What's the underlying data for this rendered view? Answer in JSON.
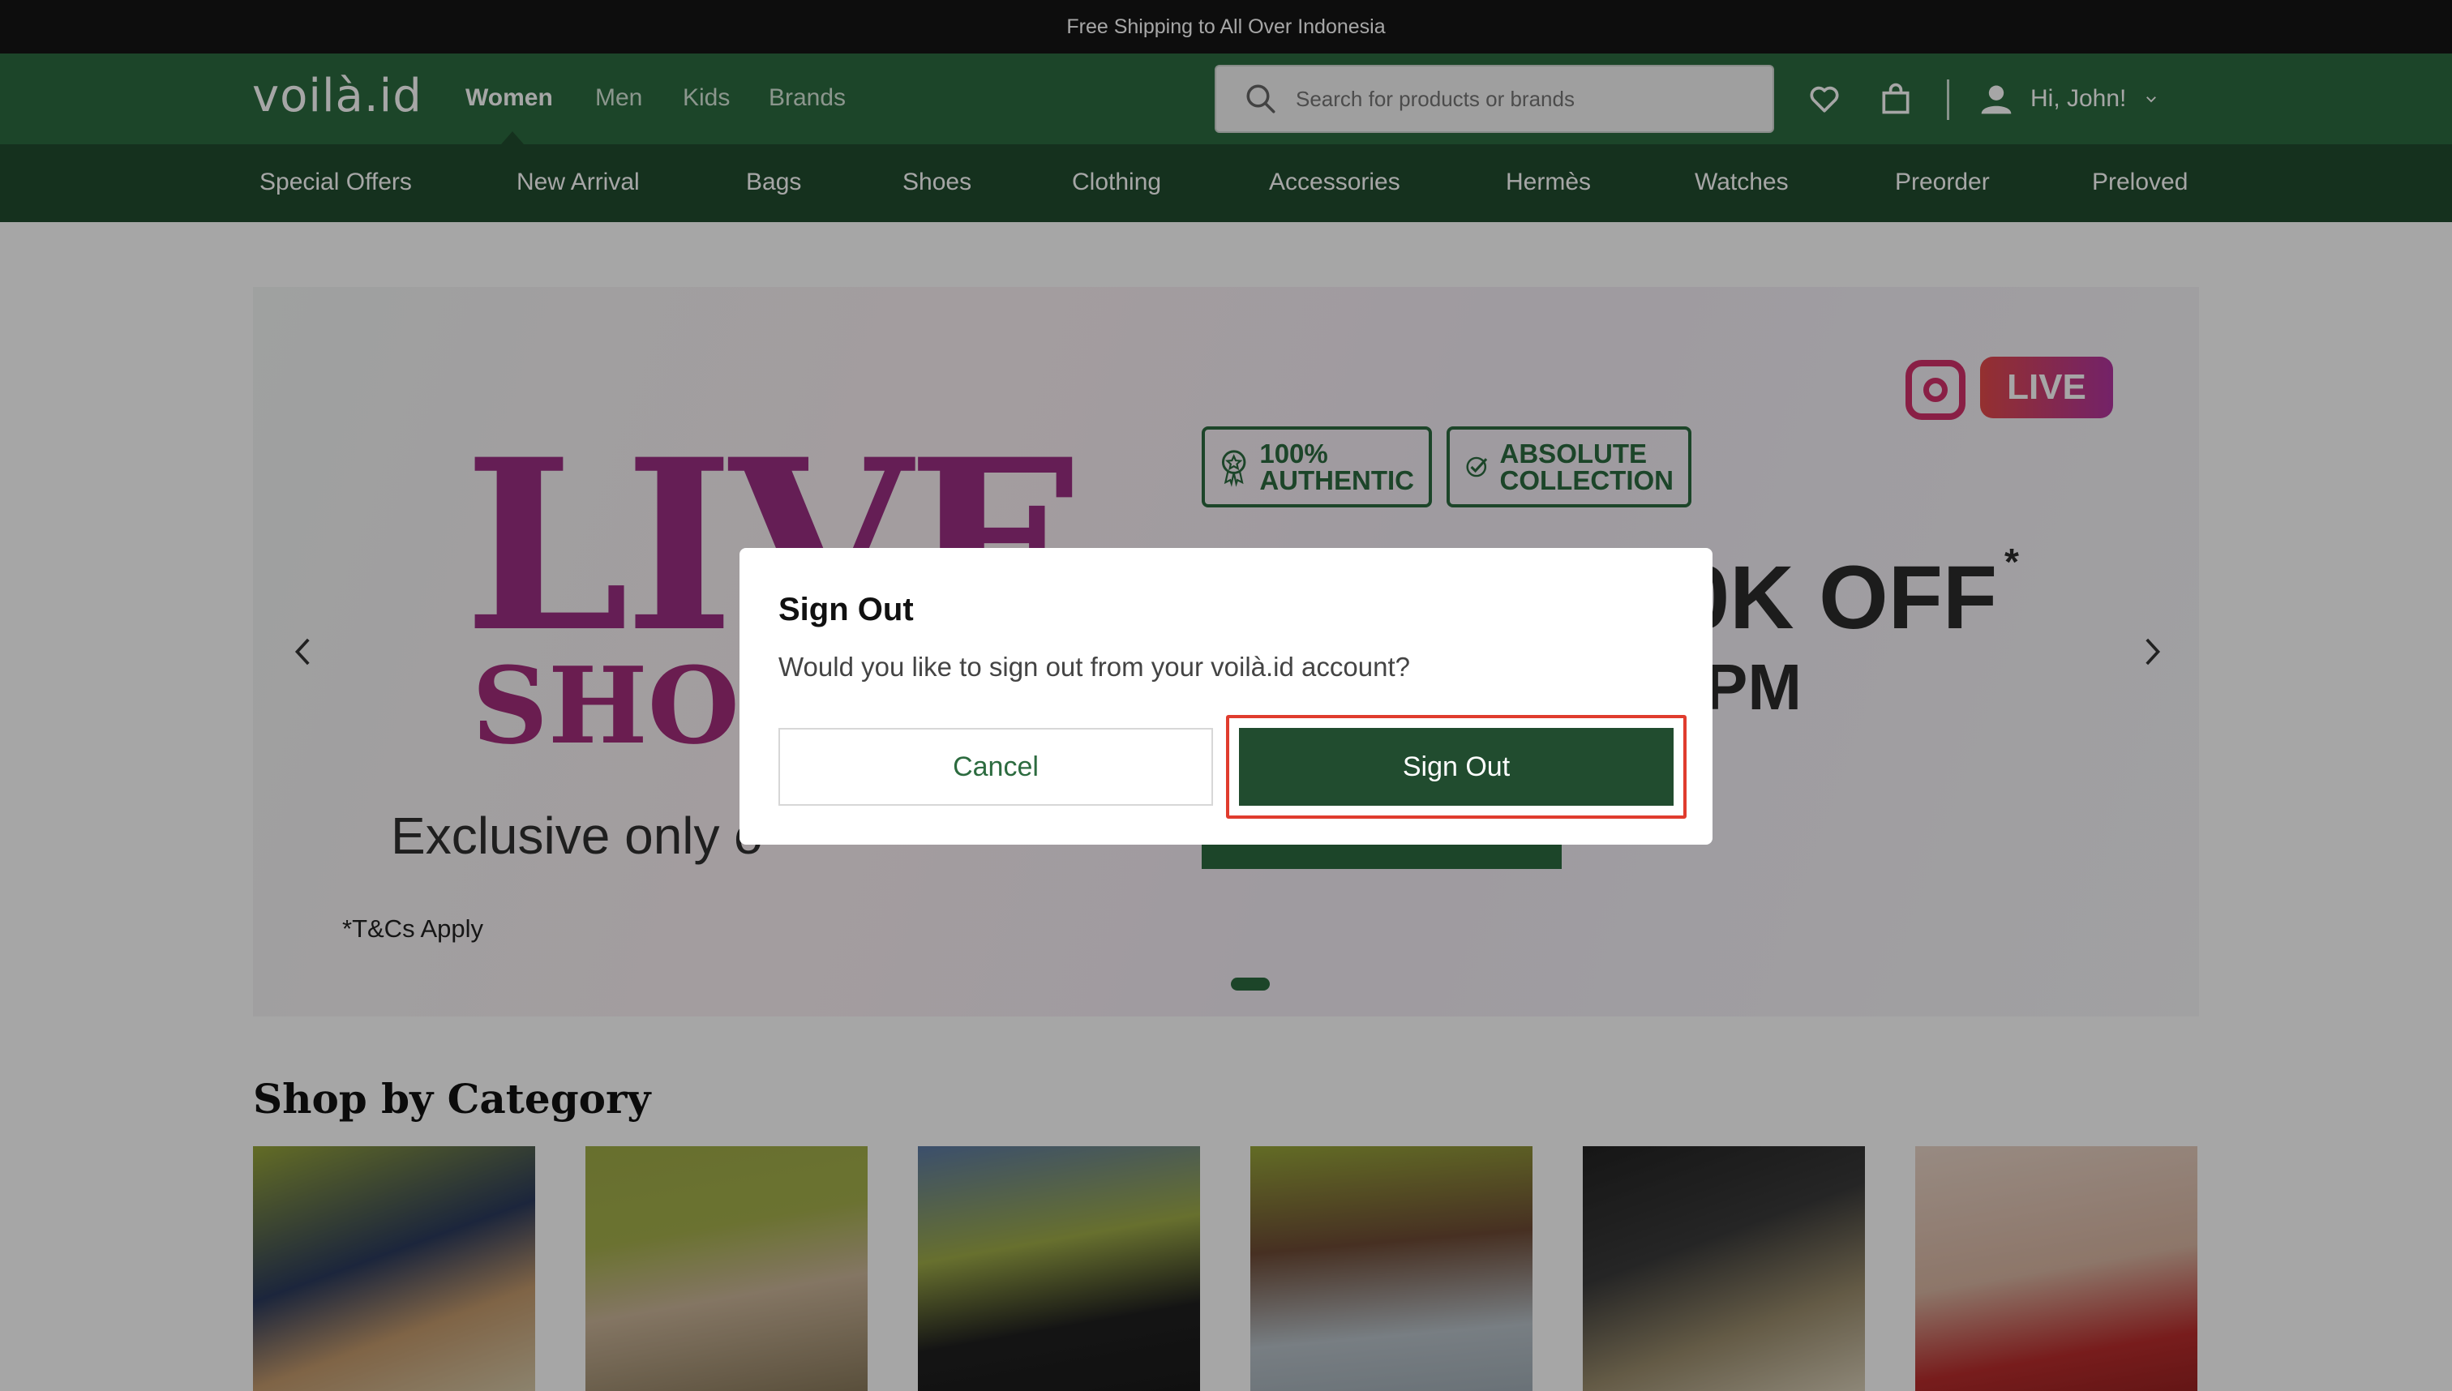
{
  "announcement": "Free Shipping to All Over Indonesia",
  "header": {
    "logo": "voilà.id",
    "gender_tabs": [
      {
        "label": "Women",
        "active": true
      },
      {
        "label": "Men"
      },
      {
        "label": "Kids"
      },
      {
        "label": "Brands"
      }
    ],
    "search_placeholder": "Search for products or brands",
    "icons": [
      "wishlist-heart-icon",
      "shopping-bag-icon",
      "user-icon",
      "chevron-down-icon"
    ],
    "user_greeting": "Hi, John!"
  },
  "category_nav": [
    "Special Offers",
    "New Arrival",
    "Bags",
    "Shoes",
    "Clothing",
    "Accessories",
    "Hermès",
    "Watches",
    "Preorder",
    "Preloved"
  ],
  "banner": {
    "headline_1": "LIVE",
    "headline_2": "SHOP",
    "subline": "Exclusive only o",
    "tnc": "*T&Cs Apply",
    "badges": [
      {
        "line1": "100%",
        "line2": "AUTHENTIC"
      },
      {
        "line1": "ABSOLUTE",
        "line2": "COLLECTION"
      }
    ],
    "live_pill": "LIVE",
    "offer": "0K OFF",
    "offer_mark": "*",
    "time": "PM"
  },
  "shop_by_category": {
    "title": "Shop by Category"
  },
  "modal": {
    "title": "Sign Out",
    "message": "Would you like to sign out from your voilà.id account?",
    "cancel_label": "Cancel",
    "confirm_label": "Sign Out"
  },
  "colors": {
    "brand_green": "#2c6b3f",
    "dark_green": "#214c2f",
    "highlight_red": "#e03c2e"
  }
}
